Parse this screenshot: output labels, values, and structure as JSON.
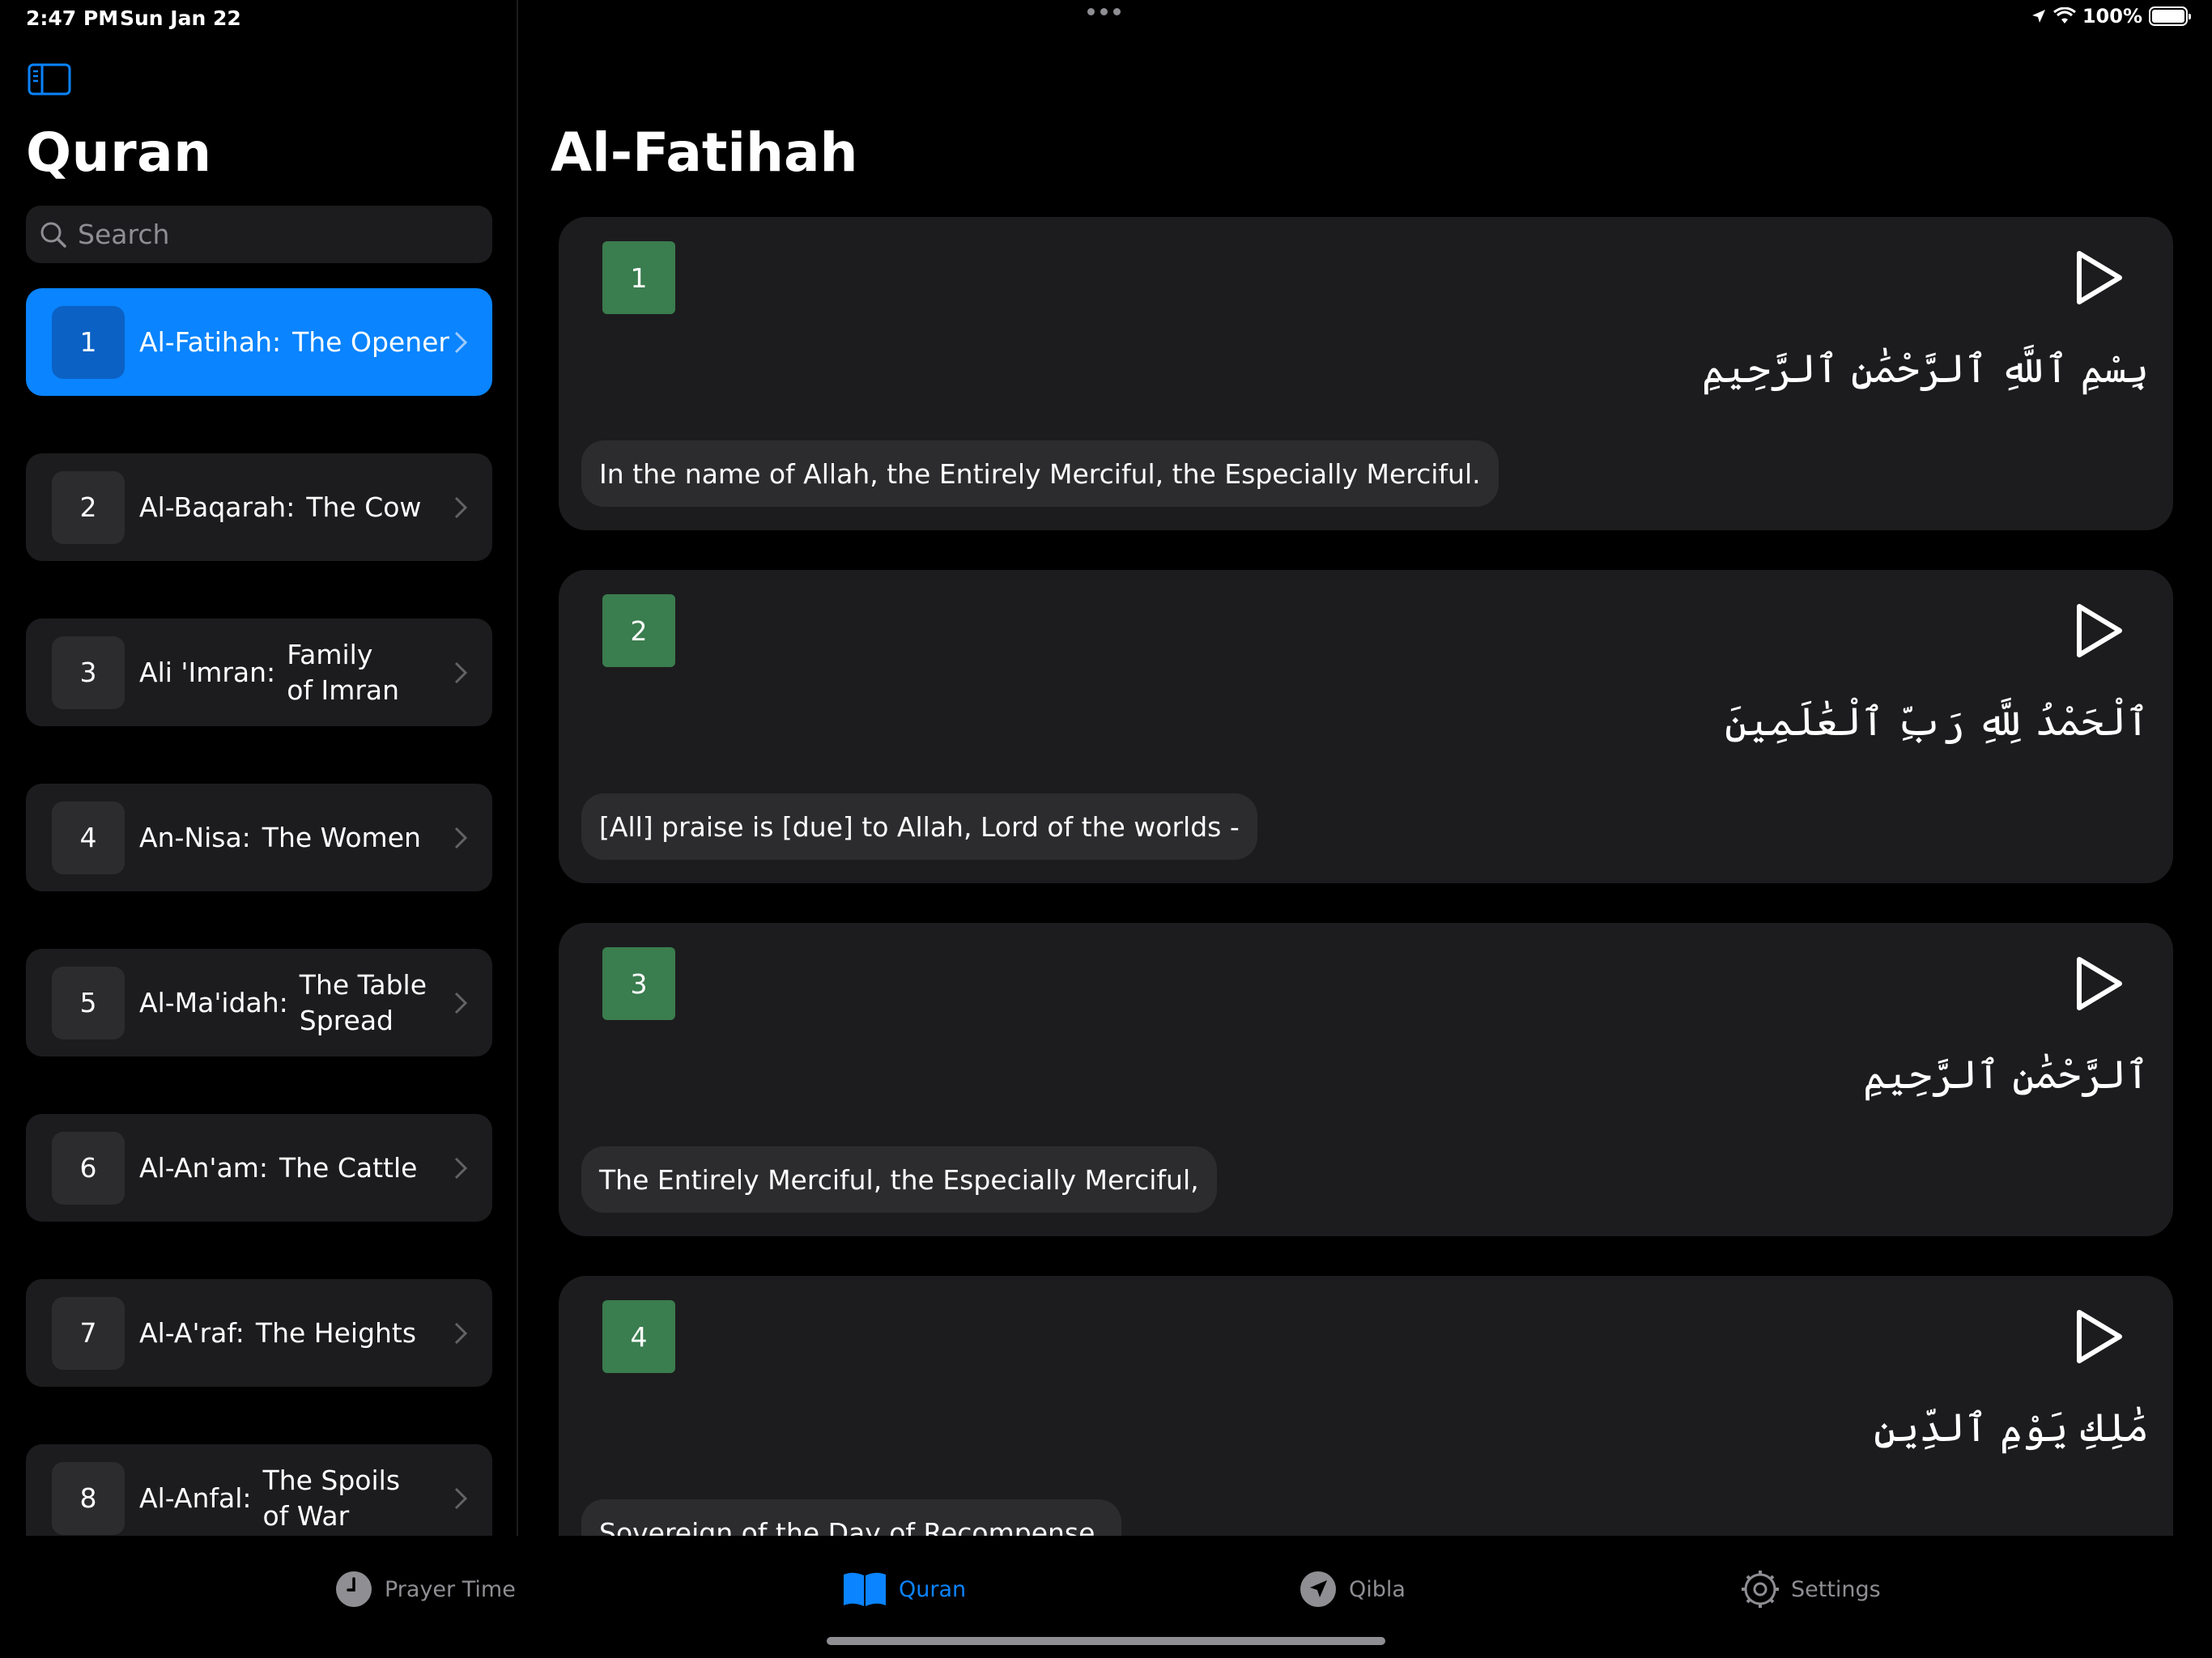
{
  "status": {
    "time": "2:47 PM",
    "date": "Sun Jan 22",
    "battery": "100%"
  },
  "sidebar": {
    "title": "Quran",
    "search_placeholder": "Search",
    "surahs": [
      {
        "number": "1",
        "name": "Al-Fatihah:",
        "meaning": "The Opener",
        "active": true
      },
      {
        "number": "2",
        "name": "Al-Baqarah:",
        "meaning": "The Cow"
      },
      {
        "number": "3",
        "name": "Ali 'Imran:",
        "meaning": "Family of Imran"
      },
      {
        "number": "4",
        "name": "An-Nisa:",
        "meaning": "The Women"
      },
      {
        "number": "5",
        "name": "Al-Ma'idah:",
        "meaning": "The Table Spread"
      },
      {
        "number": "6",
        "name": "Al-An'am:",
        "meaning": "The Cattle"
      },
      {
        "number": "7",
        "name": "Al-A'raf:",
        "meaning": "The Heights"
      },
      {
        "number": "8",
        "name": "Al-Anfal:",
        "meaning": "The Spoils of War"
      }
    ]
  },
  "main": {
    "title": "Al-Fatihah",
    "verses": [
      {
        "number": "1",
        "arabic": "بِسْمِ ٱللَّهِ ٱلرَّحْمَٰنِ ٱلرَّحِيمِ",
        "translation": "In the name of Allah, the Entirely Merciful, the Especially Merciful."
      },
      {
        "number": "2",
        "arabic": "ٱلْحَمْدُ لِلَّهِ رَبِّ ٱلْعَٰلَمِينَ",
        "translation": "[All] praise is [due] to Allah, Lord of the worlds -"
      },
      {
        "number": "3",
        "arabic": "ٱلرَّحْمَٰنِ ٱلرَّحِيمِ",
        "translation": "The Entirely Merciful, the Especially Merciful,"
      },
      {
        "number": "4",
        "arabic": "مَٰلِكِ يَوْمِ ٱلدِّينِ",
        "translation": "Sovereign of the Day of Recompense."
      }
    ]
  },
  "tabbar": {
    "tabs": [
      {
        "label": "Prayer Time",
        "icon": "clock-icon"
      },
      {
        "label": "Quran",
        "icon": "book-icon",
        "active": true
      },
      {
        "label": "Qibla",
        "icon": "compass-icon"
      },
      {
        "label": "Settings",
        "icon": "gear-icon"
      }
    ]
  },
  "colors": {
    "accent": "#0a84ff",
    "verse_badge": "#3a7d4e",
    "card": "#1c1c1e"
  }
}
